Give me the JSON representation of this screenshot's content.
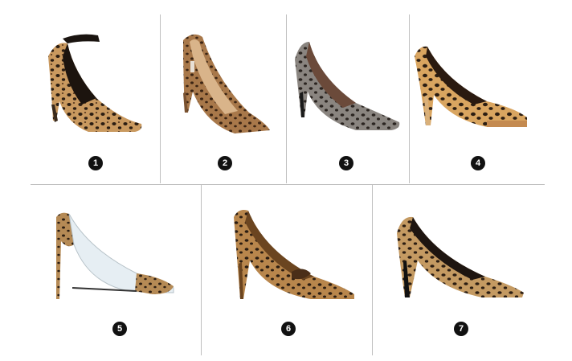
{
  "products": [
    {
      "number": "1",
      "style": "ankle-strap pointed pump",
      "heel_color": "#3a2a1c"
    },
    {
      "number": "2",
      "style": "pointed stiletto pump",
      "heel_color": "#7a5230"
    },
    {
      "number": "3",
      "style": "pointed pump",
      "heel_color": "#1a1a1a"
    },
    {
      "number": "4",
      "style": "platform pump",
      "heel_color": "#d9b07a"
    },
    {
      "number": "5",
      "style": "clear PVC pump",
      "heel_color": "#6b4a2a"
    },
    {
      "number": "6",
      "style": "bow pump",
      "heel_color": "#6b4520"
    },
    {
      "number": "7",
      "style": "pointed pump",
      "heel_color": "#111111"
    }
  ],
  "colors": {
    "leopard_base": "#c9995f",
    "leopard_spot": "#2b1d12",
    "grey_leopard_base": "#8a8580",
    "divider": "#bfbfbf",
    "badge": "#111111"
  }
}
